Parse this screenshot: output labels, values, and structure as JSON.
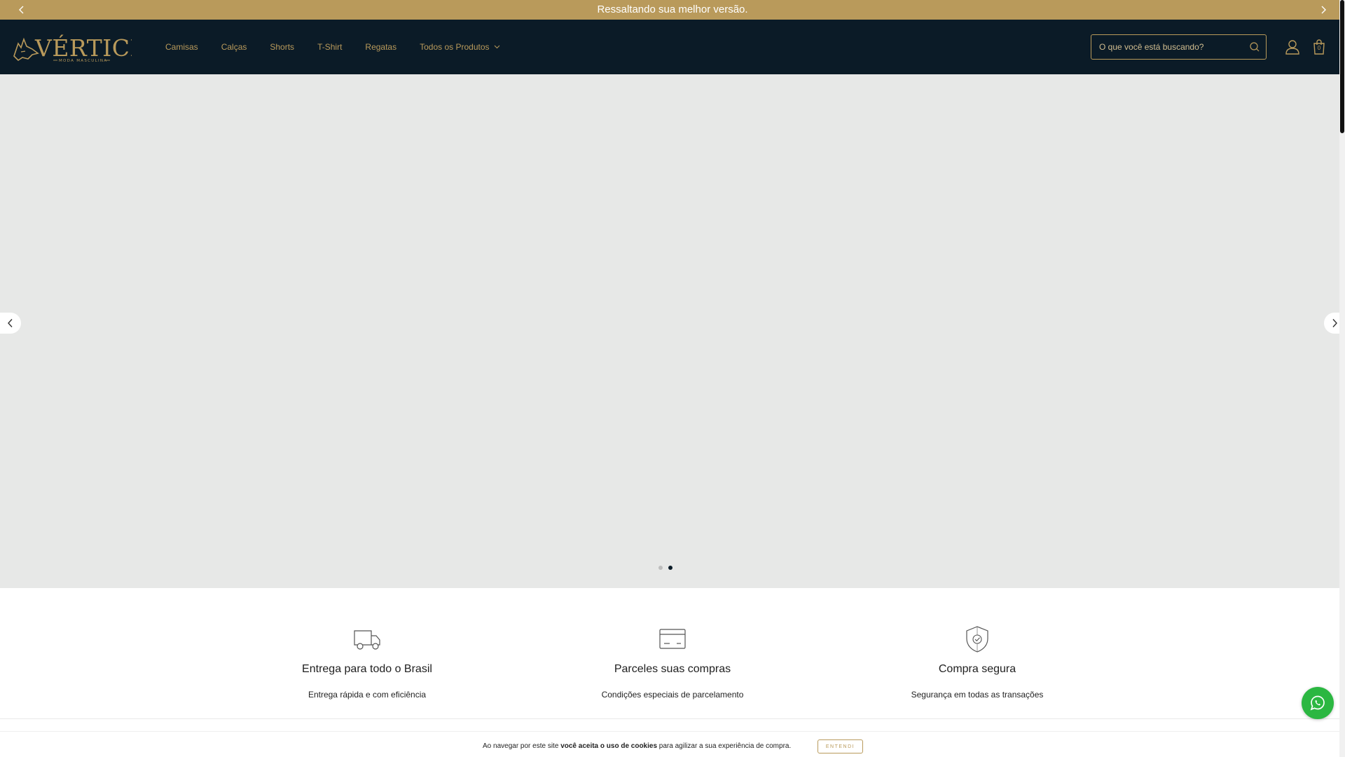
{
  "announcement": {
    "text": "Ressaltando sua melhor versão.",
    "prev_icon": "chevron-left-icon",
    "next_icon": "chevron-right-icon"
  },
  "header": {
    "logo": {
      "brand": "VÉRTICE",
      "tagline": "MODA MASCULINA"
    },
    "nav": [
      {
        "label": "Camisas"
      },
      {
        "label": "Calças"
      },
      {
        "label": "Shorts"
      },
      {
        "label": "T-Shirt"
      },
      {
        "label": "Regatas"
      },
      {
        "label": "Todos os Produtos",
        "has_dropdown": true
      }
    ],
    "search": {
      "placeholder": "O que você está buscando?",
      "value": "",
      "icon": "search-icon"
    },
    "account_icon": "user-icon",
    "cart": {
      "icon": "bag-icon",
      "count": "0"
    }
  },
  "hero": {
    "slides_total": 2,
    "active_slide": 2,
    "prev_icon": "chevron-left-icon",
    "next_icon": "chevron-right-icon"
  },
  "benefits": [
    {
      "icon": "truck-icon",
      "title": "Entrega para todo o Brasil",
      "subtitle": "Entrega rápida e com eficiência"
    },
    {
      "icon": "credit-card-icon",
      "title": "Parceles suas compras",
      "subtitle": "Condições especiais de parcelamento"
    },
    {
      "icon": "shield-check-icon",
      "title": "Compra segura",
      "subtitle": "Segurança em todas as transações"
    }
  ],
  "whatsapp": {
    "icon": "whatsapp-icon"
  },
  "cookie": {
    "text_before": "Ao navegar por este site ",
    "text_bold": "você aceita o uso de cookies",
    "text_after": " para agilizar a sua experiência de compra.",
    "button_label": "ENTENDI"
  },
  "colors": {
    "accent": "#b99a5b",
    "header_bg": "#0b1b27",
    "hero_bg": "#e7e8e7",
    "whatsapp": "#2bb741"
  }
}
